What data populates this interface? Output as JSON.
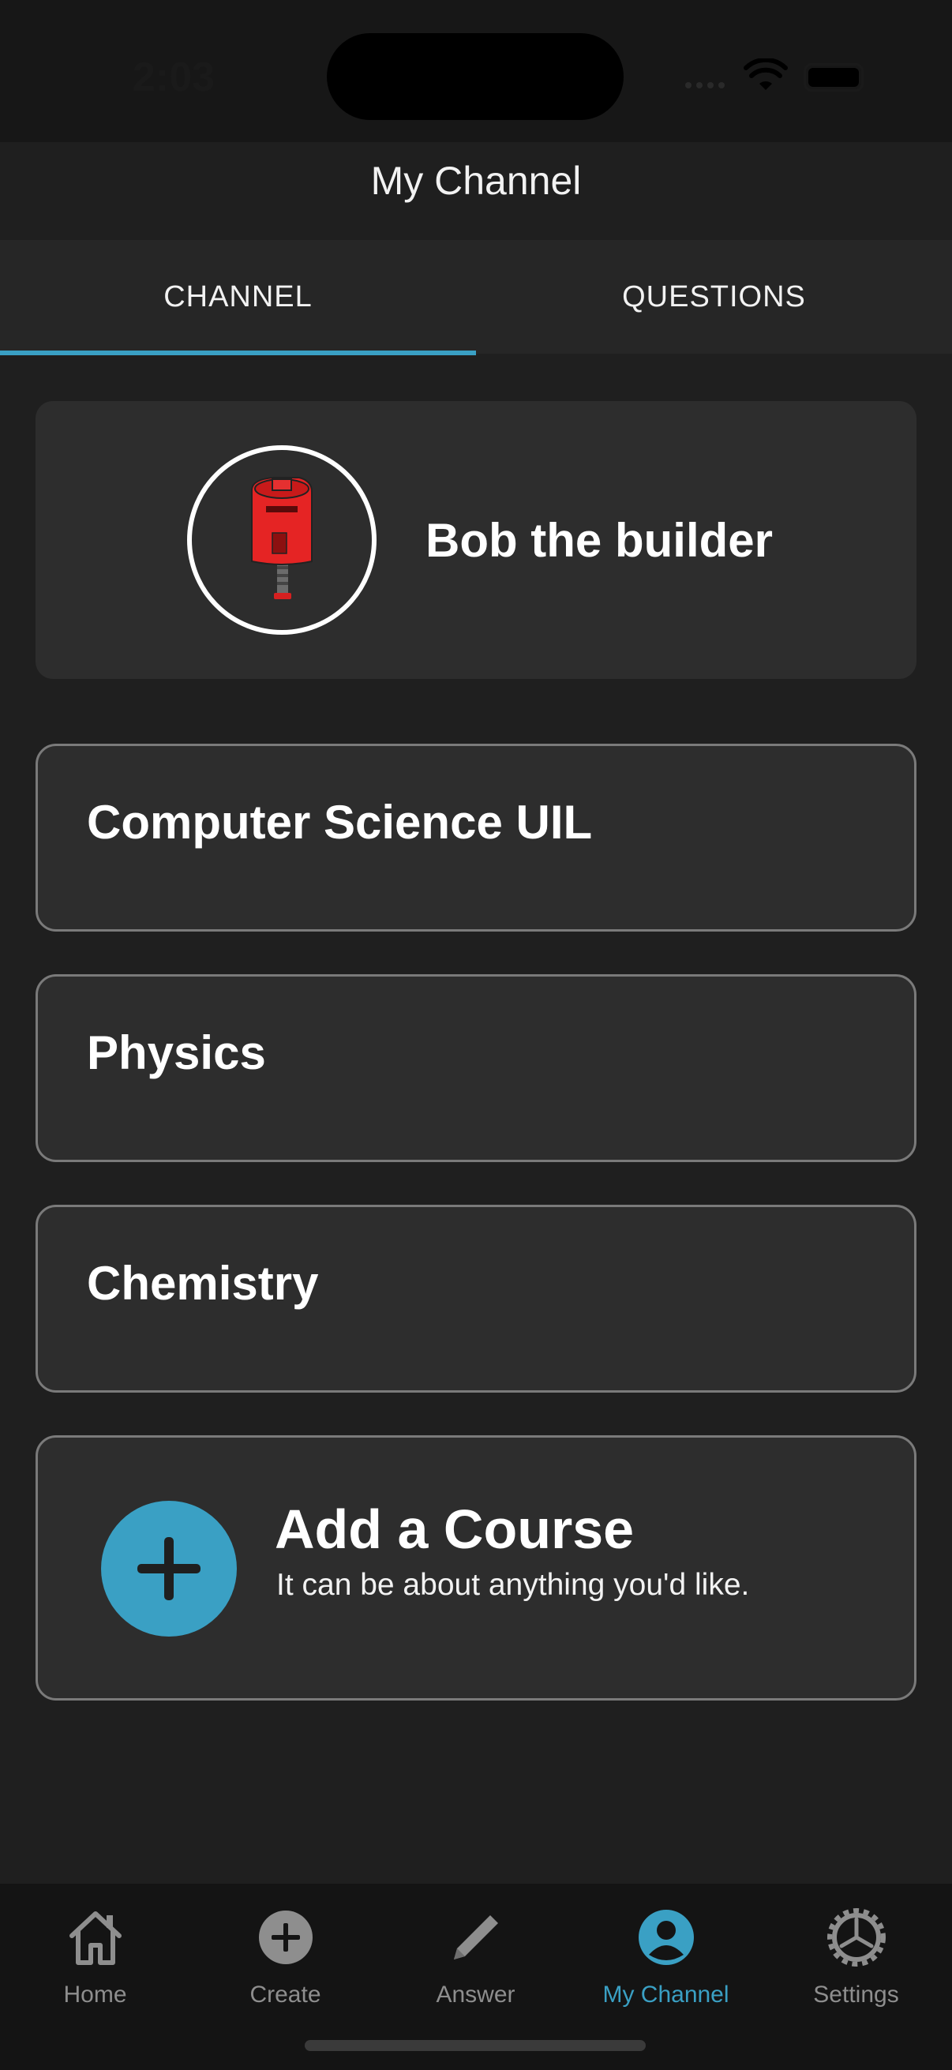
{
  "status_bar": {
    "time": "2:03"
  },
  "header": {
    "title": "My Channel"
  },
  "tabs": [
    {
      "label": "CHANNEL",
      "active": true
    },
    {
      "label": "QUESTIONS",
      "active": false
    }
  ],
  "profile": {
    "name": "Bob the builder",
    "avatar_icon": "mailbox-icon"
  },
  "courses": [
    {
      "title": "Computer Science UIL"
    },
    {
      "title": "Physics"
    },
    {
      "title": "Chemistry"
    }
  ],
  "add_course": {
    "title": "Add a Course",
    "subtitle": "It can be about anything you'd like.",
    "icon": "plus-icon"
  },
  "tabbar": [
    {
      "label": "Home",
      "icon": "home-icon",
      "active": false
    },
    {
      "label": "Create",
      "icon": "plus-circle-icon",
      "active": false
    },
    {
      "label": "Answer",
      "icon": "pencil-icon",
      "active": false
    },
    {
      "label": "My Channel",
      "icon": "user-circle-icon",
      "active": true
    },
    {
      "label": "Settings",
      "icon": "gear-icon",
      "active": false
    }
  ],
  "colors": {
    "accent": "#3aa0c4",
    "background": "#1f1f1f",
    "card": "#2d2d2d",
    "inactive": "#8e8e8e"
  }
}
